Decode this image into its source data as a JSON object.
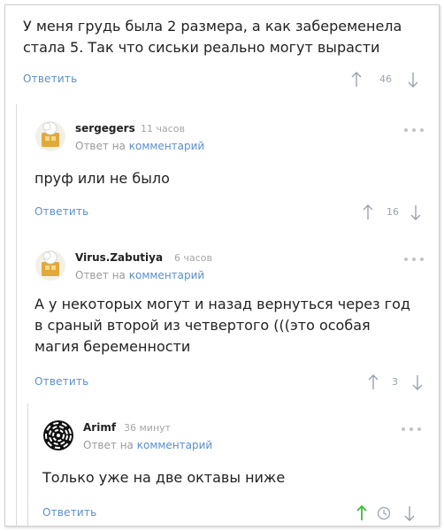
{
  "comments": [
    {
      "text_lines": [
        "У меня грудь была 2 размера, а как забеременела",
        "стала 5. Так что сиськи реально могут вырасти"
      ],
      "reply_label": "Ответить",
      "votes": "46"
    },
    {
      "author": "sergegers",
      "time": "11 часов",
      "reply_to_prefix": "Ответ на",
      "reply_to_target": "комментарий",
      "text_lines": [
        "пруф или не было"
      ],
      "reply_label": "Ответить",
      "votes": "16"
    },
    {
      "author": "Virus.Zabutiya",
      "time": "6 часов",
      "reply_to_prefix": "Ответ на",
      "reply_to_target": "комментарий",
      "text_lines": [
        "А у некоторых могут и назад вернуться через год",
        "в сраный второй из четвертого (((это особая",
        "магия беременности"
      ],
      "reply_label": "Ответить",
      "votes": "3"
    },
    {
      "author": "Arimf",
      "time": "36 минут",
      "reply_to_prefix": "Ответ на",
      "reply_to_target": "комментарий",
      "text_lines": [
        "Только уже на две октавы ниже"
      ],
      "reply_label": "Ответить",
      "votes": ""
    }
  ],
  "icons": {
    "upvote": "arrow-up-icon",
    "downvote": "arrow-down-icon",
    "more": "more-dots-icon",
    "pending": "clock-icon",
    "avatar_default": "chef-avatar-icon",
    "avatar_spiral": "spiral-avatar-icon"
  },
  "colors": {
    "link": "#5b8fc9",
    "muted": "#a6a6a6",
    "arrow": "#9aa3ad",
    "active_upvote": "#3dbb3d"
  }
}
